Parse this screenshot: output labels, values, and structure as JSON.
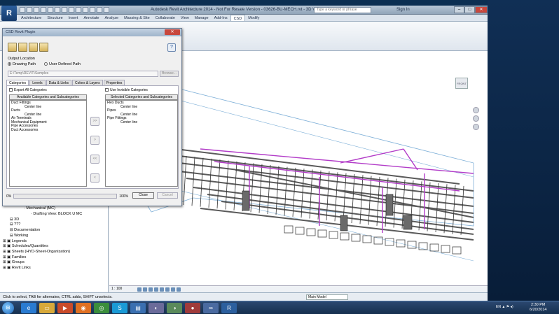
{
  "revit": {
    "title": "Autodesk Revit Architecture 2014 - Not For Resale Version -",
    "title_view": "03626-BU-MECH.rvt - 3D View: DD5",
    "search_placeholder": "Type a keyword or phrase",
    "sign_in": "Sign In",
    "app_letter": "R",
    "ribbon_tabs": [
      "Architecture",
      "Structure",
      "Insert",
      "Annotate",
      "Analyze",
      "Massing & Site",
      "Collaborate",
      "View",
      "Manage",
      "Add-Ins",
      "CSD",
      "Modify"
    ],
    "active_tab": "CSD"
  },
  "dialog": {
    "title": "CSD Revit Plugin",
    "output_location": "Output Location",
    "radio_drawing_path": "Drawing Path",
    "radio_user_path": "User Defined Path",
    "path_value": "E:\\Temp\\REVIT\\Samples",
    "browse_label": "Browse...",
    "tabs": [
      "Categories",
      "Levels",
      "Data & Links",
      "Colors & Layers",
      "Properties"
    ],
    "active_tab": "Categories",
    "export_all": "Export All Categories",
    "use_invisible": "Use Invisible Categories",
    "available_header": "Available Categories and Subcategories",
    "selected_header": "Selected Categories and Subcategories",
    "available_items": [
      {
        "label": "Duct Fittings",
        "level": 0
      },
      {
        "label": "Center line",
        "level": 1
      },
      {
        "label": "Ducts",
        "level": 0
      },
      {
        "label": "Center line",
        "level": 1
      },
      {
        "label": "Air Terminals",
        "level": 0
      },
      {
        "label": "Mechanical Equipment",
        "level": 0
      },
      {
        "label": "Pipe Accessories",
        "level": 0
      },
      {
        "label": "Duct Accessories",
        "level": 0
      }
    ],
    "selected_items": [
      {
        "label": "Flex Ducts",
        "level": 0
      },
      {
        "label": "Center line",
        "level": 1
      },
      {
        "label": "Pipes",
        "level": 0
      },
      {
        "label": "Center line",
        "level": 1
      },
      {
        "label": "Pipe Fittings",
        "level": 0
      },
      {
        "label": "Center line",
        "level": 1
      }
    ],
    "arrow_buttons": [
      ">>",
      ">",
      "<<",
      "<"
    ],
    "progress_start": "0%",
    "progress_end": "100%",
    "progress_value": 0,
    "close_label": "Close",
    "cancel_label": "Cancel"
  },
  "project_browser": [
    {
      "label": "Work Plans",
      "indent": 1
    },
    {
      "label": "Office",
      "indent": 2
    },
    {
      "label": "Mechanical (MC)",
      "indent": 3
    },
    {
      "label": "Drafting View: BLOCK U MC",
      "indent": 4
    },
    {
      "label": "3D",
      "indent": 1
    },
    {
      "label": "???",
      "indent": 1
    },
    {
      "label": "Documentation",
      "indent": 1
    },
    {
      "label": "Working",
      "indent": 1
    },
    {
      "label": "Legends",
      "indent": 0
    },
    {
      "label": "Schedules/Quantities",
      "indent": 0
    },
    {
      "label": "Sheets (HYD-Sheet-Organization)",
      "indent": 0
    },
    {
      "label": "Families",
      "indent": 0
    },
    {
      "label": "Groups",
      "indent": 0
    },
    {
      "label": "Revit Links",
      "indent": 0
    }
  ],
  "view": {
    "scale": "1 : 100",
    "viewcube_top": "TOP",
    "viewcube_face": "FRONT"
  },
  "status": {
    "text": "Click to select, TAB for alternates, CTRL adds, SHIFT unselects.",
    "model": "Main Model"
  },
  "taskbar": {
    "lang": "EN",
    "time": "2:30 PM",
    "date": "6/20/2014"
  },
  "colors": {
    "pipe_purple": "#b23cc8",
    "pipe_gray": "#5a5a5a",
    "selection_blue": "#7fb0d8"
  }
}
